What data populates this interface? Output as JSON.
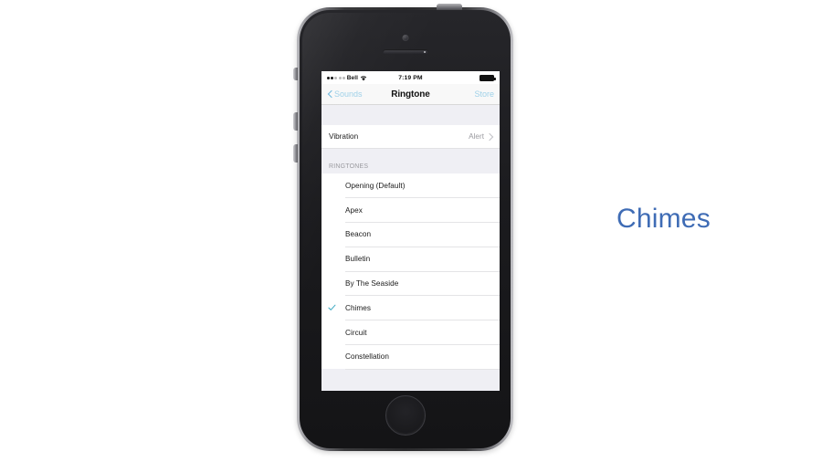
{
  "device": {
    "name": "iphone-5s-space-gray",
    "buttons": [
      "mute-switch",
      "volume-up",
      "volume-down",
      "power-button",
      "home-button"
    ]
  },
  "status_bar": {
    "signal_dots_filled": 2,
    "signal_dots_empty": 3,
    "carrier": "Bell",
    "wifi_icon": "wifi-icon",
    "time": "7:19 PM",
    "battery_icon": "battery-full-icon"
  },
  "nav_bar": {
    "back_label": "Sounds",
    "back_icon": "chevron-left-icon",
    "title": "Ringtone",
    "right_label": "Store"
  },
  "settings": {
    "vibration_row": {
      "label": "Vibration",
      "value": "Alert",
      "disclosure_icon": "chevron-right-icon"
    },
    "section_header": "RINGTONES",
    "selected": "Chimes",
    "check_icon": "checkmark-icon",
    "ringtones": [
      {
        "label": "Opening (Default)",
        "selected": false
      },
      {
        "label": "Apex",
        "selected": false
      },
      {
        "label": "Beacon",
        "selected": false
      },
      {
        "label": "Bulletin",
        "selected": false
      },
      {
        "label": "By The Seaside",
        "selected": false
      },
      {
        "label": "Chimes",
        "selected": true
      },
      {
        "label": "Circuit",
        "selected": false
      },
      {
        "label": "Constellation",
        "selected": false
      }
    ]
  },
  "caption": {
    "text": "Chimes",
    "color": "#3f6cb5"
  },
  "colors": {
    "accent_blue": "#3f6cb5",
    "nav_tint": "#9fd1e8",
    "check_teal": "#3aa8c1",
    "group_background": "#efeff4",
    "row_background": "#ffffff",
    "page_background": "#ffffff"
  }
}
